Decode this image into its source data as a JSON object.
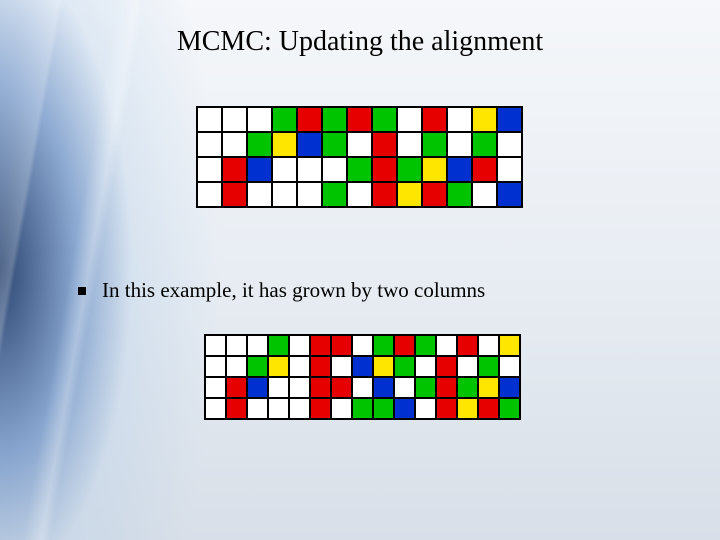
{
  "title": "MCMC: Updating the alignment",
  "bullet": "In this example, it has grown by two columns",
  "colors": {
    "W": "#ffffff",
    "G": "#00c400",
    "R": "#e60000",
    "B": "#0030d0",
    "Y": "#ffe600"
  },
  "grid1": {
    "cols": 13,
    "rows": 4,
    "cells": [
      [
        "W",
        "W",
        "W",
        "G",
        "R",
        "G",
        "R",
        "G",
        "W",
        "R",
        "W",
        "Y",
        "B"
      ],
      [
        "W",
        "W",
        "G",
        "Y",
        "B",
        "G",
        "W",
        "R",
        "W",
        "G",
        "W",
        "G",
        "W"
      ],
      [
        "W",
        "R",
        "B",
        "W",
        "W",
        "W",
        "G",
        "R",
        "G",
        "Y",
        "B",
        "R",
        "W"
      ],
      [
        "W",
        "R",
        "W",
        "W",
        "W",
        "G",
        "W",
        "R",
        "Y",
        "R",
        "G",
        "W",
        "B"
      ]
    ]
  },
  "grid2": {
    "cols": 15,
    "rows": 4,
    "cells": [
      [
        "W",
        "W",
        "W",
        "G",
        "W",
        "R",
        "R",
        "W",
        "G",
        "R",
        "G",
        "W",
        "R",
        "W",
        "Y"
      ],
      [
        "W",
        "W",
        "G",
        "Y",
        "W",
        "R",
        "W",
        "B",
        "Y",
        "G",
        "W",
        "R",
        "W",
        "G",
        "W"
      ],
      [
        "W",
        "R",
        "B",
        "W",
        "W",
        "R",
        "R",
        "W",
        "B",
        "W",
        "G",
        "R",
        "G",
        "Y",
        "B"
      ],
      [
        "W",
        "R",
        "W",
        "W",
        "W",
        "R",
        "W",
        "G",
        "G",
        "B",
        "W",
        "R",
        "Y",
        "R",
        "G"
      ]
    ]
  }
}
